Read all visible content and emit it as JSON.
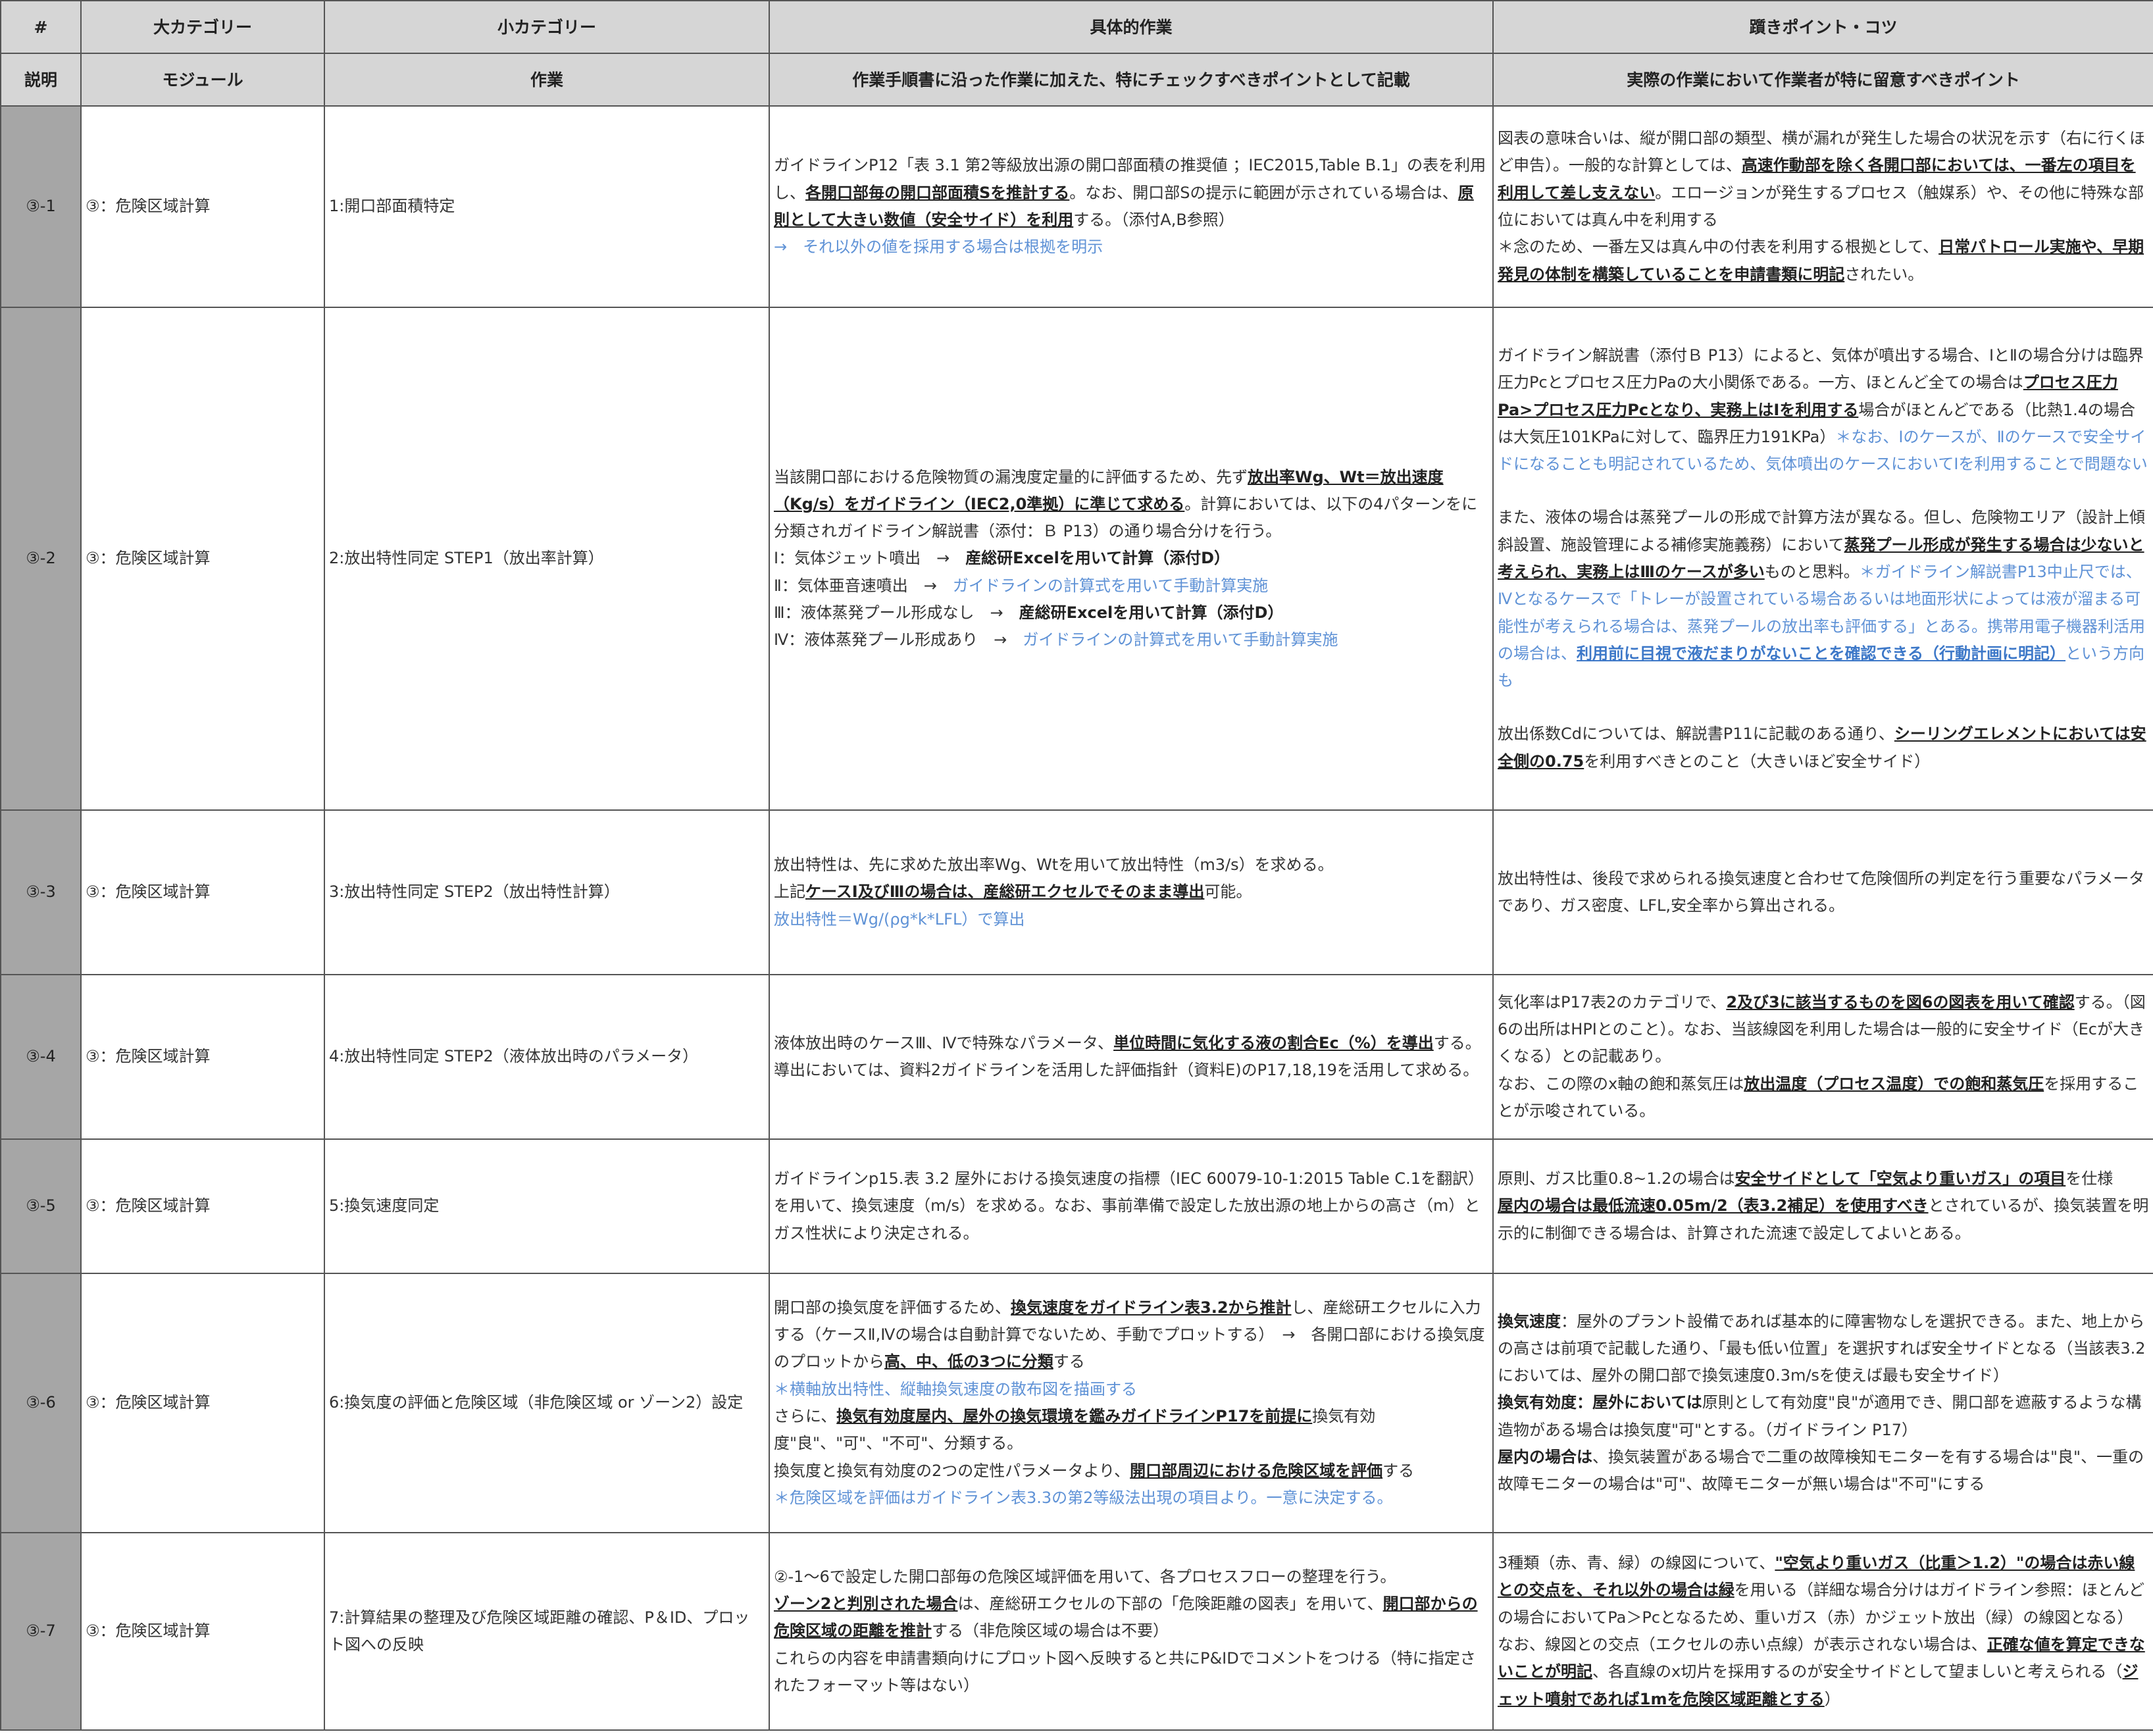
{
  "header": {
    "col_num": "#",
    "col_major": "大カテゴリー",
    "col_minor": "小カテゴリー",
    "col_work": "具体的作業",
    "col_tips": "躓きポイント・コツ"
  },
  "subheader": {
    "col_num": "説明",
    "col_major": "モジュール",
    "col_minor": "作業",
    "col_work": "作業手順書に沿った作業に加えた、特にチェックすべきポイントとして記載",
    "col_tips": "実際の作業において作業者が特に留意すべきポイント"
  },
  "rows": [
    {
      "num": "③-1",
      "module": "③：危険区域計算",
      "task": "1:開口部面積特定",
      "work": {
        "p1a": "ガイドラインP12「表 3.1 第2等級放出源の開口部面積の推奨値 ；IEC2015,Table B.1」の表を利用し、",
        "p1b": "各開口部毎の開口部面積Sを推計する",
        "p1c": "。なお、開口部Sの提示に範囲が示されている場合は、",
        "p1d": "原則として大きい数値（安全サイド）を利用",
        "p1e": "する。（添付A,B参照）",
        "p2": "→　それ以外の値を採用する場合は根拠を明示"
      },
      "tips": {
        "p1a": "図表の意味合いは、縦が開口部の類型、横が漏れが発生した場合の状況を示す（右に行くほど申告）。一般的な計算としては、",
        "p1b": "高速作動部を除く各開口部においては、一番左の項目を利用して差し支えない",
        "p1c": "。エロージョンが発生するプロセス（触媒系）や、その他に特殊な部位においては真ん中を利用する",
        "p2a": "＊念のため、一番左又は真ん中の付表を利用する根拠として、",
        "p2b": "日常パトロール実施や、早期発見の体制を構築していることを申請書類に明記",
        "p2c": "されたい。"
      }
    },
    {
      "num": "③-2",
      "module": "③：危険区域計算",
      "task": "2:放出特性同定 STEP1（放出率計算）",
      "work": {
        "p1a": "当該開口部における危険物質の漏洩度定量的に評価するため、先ず",
        "p1b": "放出率Wg、Wt＝放出速度（Kg/s）をガイドライン（IEC2,0準拠）に準じて求める",
        "p1c": "。計算においては、以下の4パターンをに分類されガイドライン解説書（添付：Ｂ P13）の通り場合分けを行う。",
        "l1a": "Ⅰ：気体ジェット噴出　→　",
        "l1b": "産総研Excelを用いて計算（添付D）",
        "l2a": "Ⅱ：気体亜音速噴出　→　",
        "l2b": "ガイドラインの計算式を用いて手動計算実施",
        "l3a": "Ⅲ：液体蒸発プール形成なし　→　",
        "l3b": "産総研Excelを用いて計算（添付D）",
        "l4a": "Ⅳ：液体蒸発プール形成あり　→　",
        "l4b": "ガイドラインの計算式を用いて手動計算実施"
      },
      "tips": {
        "p1a": "ガイドライン解説書（添付Ｂ P13）によると、気体が噴出する場合、ⅠとⅡの場合分けは臨界圧力Pcとプロセス圧力Paの大小関係である。一方、ほとんど全ての場合は",
        "p1b": "プロセス圧力Pa>プロセス圧力Pcとなり、実務上はⅠを利用する",
        "p1c": "場合がほとんどである（比熱1.4の場合は大気圧101KPaに対して、臨界圧力191KPa）",
        "p1d": "＊なお、Ⅰのケースが、Ⅱのケースで安全サイドになることも明記されているため、気体噴出のケースにおいてⅠを利用することで問題ない",
        "p2a": "また、液体の場合は蒸発プールの形成で計算方法が異なる。但し、危険物エリア（設計上傾斜設置、施設管理による補修実施義務）において",
        "p2b": "蒸発プール形成が発生する場合は少ないと考えられ、実務上はⅢのケースが多い",
        "p2c": "ものと思料。",
        "p2d": "＊ガイドライン解説書P13中止尺では、Ⅳとなるケースで「トレーが設置されている場合あるいは地面形状によっては液が溜まる可能性が考えられる場合は、蒸発プールの放出率も評価する」とある。携帯用電子機器利活用の場合は、",
        "p2e": "利用前に目視で液だまりがないことを確認できる（行動計画に明記）",
        "p2f": "という方向も",
        "p3a": "放出係数Cdについては、解説書P11に記載のある通り、",
        "p3b": "シーリングエレメントにおいては安全側の0.75",
        "p3c": "を利用すべきとのこと（大きいほど安全サイド）"
      }
    },
    {
      "num": "③-3",
      "module": "③：危険区域計算",
      "task": "3:放出特性同定 STEP2（放出特性計算）",
      "work": {
        "p1": "放出特性は、先に求めた放出率Wg、Wtを用いて放出特性（m3/s）を求める。",
        "p2a": "上記",
        "p2b": "ケースⅠ及びⅢの場合は、産総研エクセルでそのまま導出",
        "p2c": "可能。",
        "p3": "放出特性＝Wg/(ρg*k*LFL）で算出"
      },
      "tips": {
        "p1": "放出特性は、後段で求められる換気速度と合わせて危険個所の判定を行う重要なパラメータであり、ガス密度、LFL,安全率から算出される。"
      }
    },
    {
      "num": "③-4",
      "module": "③：危険区域計算",
      "task": "4:放出特性同定 STEP2（液体放出時のパラメータ）",
      "work": {
        "p1a": "液体放出時のケースⅢ、Ⅳで特殊なパラメータ、",
        "p1b": "単位時間に気化する液の割合Ec（%）を導出",
        "p1c": "する。導出においては、資料2ガイドラインを活用した評価指針（資料E)のP17,18,19を活用して求める。"
      },
      "tips": {
        "p1a": "気化率はP17表2のカテゴリで、",
        "p1b": "2及び3に該当するものを図6の図表を用いて確認",
        "p1c": "する。（図6の出所はHPIとのこと）。なお、当該線図を利用した場合は一般的に安全サイド（Ecが大きくなる）との記載あり。",
        "p2a": "なお、この際のx軸の飽和蒸気圧は",
        "p2b": "放出温度（プロセス温度）での飽和蒸気圧",
        "p2c": "を採用することが示唆されている。"
      }
    },
    {
      "num": "③-5",
      "module": "③：危険区域計算",
      "task": "5:換気速度同定",
      "work": {
        "p1": "ガイドラインp15.表 3.2 屋外における換気速度の指標（IEC 60079-10-1:2015 Table C.1を翻訳）を用いて、換気速度（m/s）を求める。なお、事前準備で設定した放出源の地上からの高さ（m）とガス性状により決定される。"
      },
      "tips": {
        "p1a": "原則、ガス比重0.8~1.2の場合は",
        "p1b": "安全サイドとして「空気より重いガス」の項目",
        "p1c": "を仕様",
        "p1d": "屋内の場合は最低流速0.05m/2（表3.2補足）を使用すべき",
        "p1e": "とされているが、換気装置を明示的に制御できる場合は、計算された流速で設定してよいとある。"
      }
    },
    {
      "num": "③-6",
      "module": "③：危険区域計算",
      "task": "6:換気度の評価と危険区域（非危険区域 or ゾーン2）設定",
      "work": {
        "p1a": "開口部の換気度を評価するため、",
        "p1b": "換気速度をガイドライン表3.2から推計",
        "p1c": "し、産総研エクセルに入力する（ケースⅡ,Ⅳの場合は自動計算でないため、手動でプロットする）　→　各開口部における換気度のプロットから",
        "p1d": "高、中、低の3つに分類",
        "p1e": "する",
        "p2": "＊横軸放出特性、縦軸換気速度の散布図を描画する",
        "p3a": "さらに、",
        "p3b": "換気有効度屋内、屋外の換気環境を鑑みガイドラインP17を前提に",
        "p3c": "換気有効度\"良\"、\"可\"、\"不可\"、分類する。",
        "p4a": "換気度と換気有効度の2つの定性パラメータより、",
        "p4b": "開口部周辺における危険区域を評価",
        "p4c": "する",
        "p5": "＊危険区域を評価はガイドライン表3.3の第2等級法出現の項目より。一意に決定する。"
      },
      "tips": {
        "p1a": "換気速度",
        "p1b": "：屋外のプラント設備であれば基本的に障害物なしを選択できる。また、地上からの高さは前項で記載した通り、「最も低い位置」を選択すれば安全サイドとなる（当該表3.2においては、屋外の開口部で換気速度0.3m/sを使えば最も安全サイド）",
        "p2a": "換気有効度：屋外においては",
        "p2b": "原則として有効度\"良\"が適用でき、開口部を遮蔽するような構造物がある場合は換気度\"可\"とする。（ガイドライン P17）",
        "p3a": "屋内の場合は",
        "p3b": "、換気装置がある場合で二重の故障検知モニターを有する場合は\"良\"、一重の故障モニターの場合は\"可\"、故障モニターが無い場合は\"不可\"にする"
      }
    },
    {
      "num": "③-7",
      "module": "③：危険区域計算",
      "task": "7:計算結果の整理及び危険区域距離の確認、P＆ID、プロット図への反映",
      "work": {
        "p1": "②-1～6で設定した開口部毎の危険区域評価を用いて、各プロセスフローの整理を行う。",
        "p2a": "ゾーン2と判別された場合",
        "p2b": "は、産総研エクセルの下部の「危険距離の図表」を用いて、",
        "p2c": "開口部からの危険区域の距離を推計",
        "p2d": "する（非危険区域の場合は不要）",
        "p3": "これらの内容を申請書類向けにプロット図へ反映すると共にP&IDでコメントをつける（特に指定されたフォーマット等はない）"
      },
      "tips": {
        "p1a": "3種類（赤、青、緑）の線図について、",
        "p1b": "\"空気より重いガス（比重＞1.2）\"の場合は赤い線との交点を、それ以外の場合は緑",
        "p1c": "を用いる（詳細な場合分けはガイドライン参照：ほとんどの場合においてPa＞Pcとなるため、重いガス（赤）かジェット放出（緑）の線図となる）",
        "p2a": "なお、線図との交点（エクセルの赤い点線）が表示されない場合は、",
        "p2b": "正確な値を算定できないことが明記",
        "p2c": "、各直線のx切片を採用するのが安全サイドとして望ましいと考えられる（",
        "p2d": "ジェット噴射であれば1mを危険区域距離とする",
        "p2e": "）"
      }
    }
  ]
}
